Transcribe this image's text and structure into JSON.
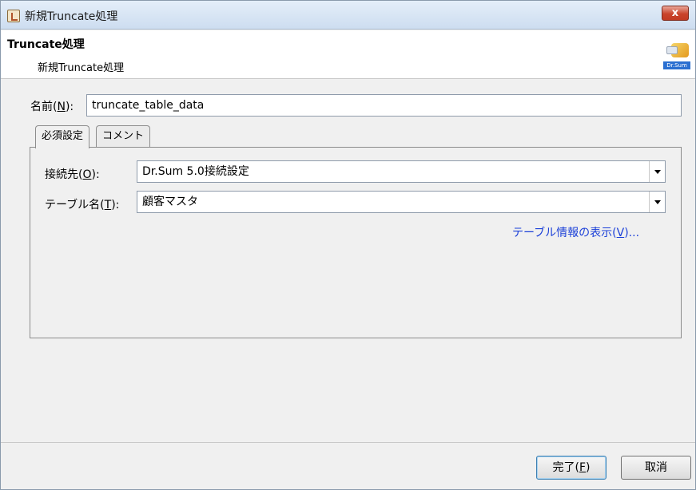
{
  "window": {
    "title": "新規Truncate処理",
    "close_label": "x"
  },
  "header": {
    "title": "Truncate処理",
    "subtitle": "新規Truncate処理",
    "logo_text": "Dr.Sum"
  },
  "form": {
    "name_label": "名前(",
    "name_mnemonic": "N",
    "name_label_end": "):",
    "name_value": "truncate_table_data"
  },
  "tabs": [
    {
      "label": "必須設定",
      "active": true
    },
    {
      "label": "コメント",
      "active": false
    }
  ],
  "required": {
    "connection_label": "接続先(",
    "connection_mnemonic": "O",
    "connection_label_end": "):",
    "connection_value": "Dr.Sum 5.0接続設定",
    "table_label": "テーブル名(",
    "table_mnemonic": "T",
    "table_label_end": "):",
    "table_value": "顧客マスタ",
    "table_info_link": "テーブル情報の表示(",
    "table_info_mnemonic": "V",
    "table_info_end": ")..."
  },
  "footer": {
    "finish_label": "完了(",
    "finish_mnemonic": "F",
    "finish_end": ")",
    "cancel_label": "取消"
  }
}
